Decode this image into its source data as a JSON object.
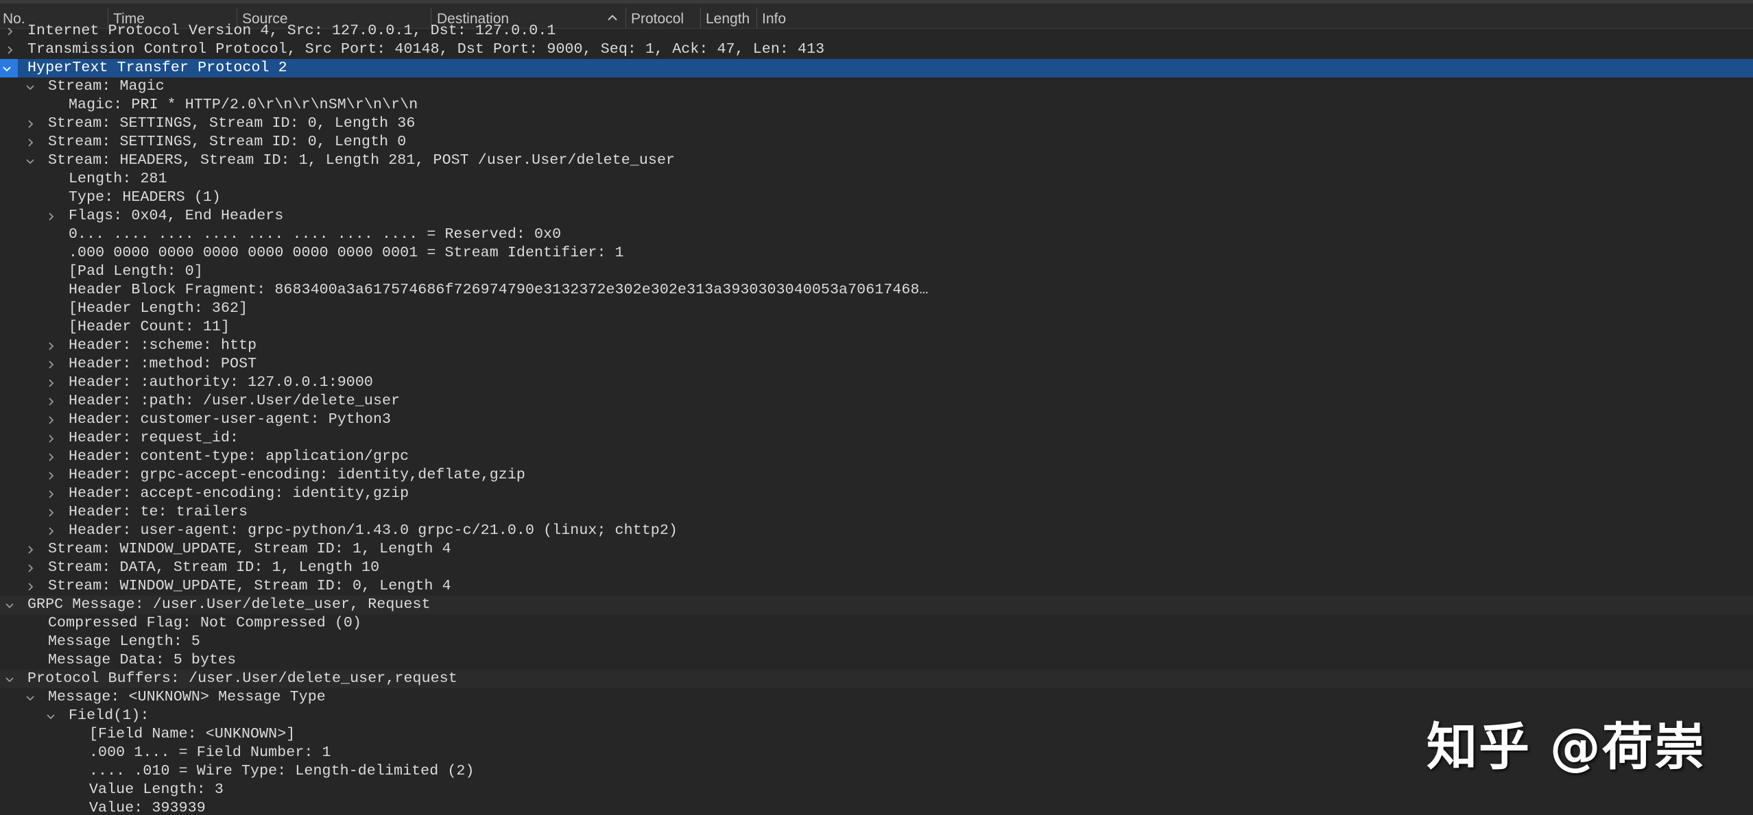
{
  "columns": {
    "no": "No.",
    "time": "Time",
    "source": "Source",
    "destination": "Destination",
    "protocol": "Protocol",
    "length": "Length",
    "info": "Info"
  },
  "tree": [
    {
      "depth": 0,
      "toggle": "collapsed",
      "text": "Internet Protocol Version 4, Src: 127.0.0.1, Dst: 127.0.0.1"
    },
    {
      "depth": 0,
      "toggle": "collapsed",
      "text": "Transmission Control Protocol, Src Port: 40148, Dst Port: 9000, Seq: 1, Ack: 47, Len: 413"
    },
    {
      "depth": 0,
      "toggle": "expanded",
      "text": "HyperText Transfer Protocol 2",
      "selected": true
    },
    {
      "depth": 1,
      "toggle": "expanded",
      "text": "Stream: Magic"
    },
    {
      "depth": 2,
      "toggle": "none",
      "text": "Magic: PRI * HTTP/2.0\\r\\n\\r\\nSM\\r\\n\\r\\n"
    },
    {
      "depth": 1,
      "toggle": "collapsed",
      "text": "Stream: SETTINGS, Stream ID: 0, Length 36"
    },
    {
      "depth": 1,
      "toggle": "collapsed",
      "text": "Stream: SETTINGS, Stream ID: 0, Length 0"
    },
    {
      "depth": 1,
      "toggle": "expanded",
      "text": "Stream: HEADERS, Stream ID: 1, Length 281, POST /user.User/delete_user"
    },
    {
      "depth": 2,
      "toggle": "none",
      "text": "Length: 281"
    },
    {
      "depth": 2,
      "toggle": "none",
      "text": "Type: HEADERS (1)"
    },
    {
      "depth": 2,
      "toggle": "collapsed",
      "text": "Flags: 0x04, End Headers"
    },
    {
      "depth": 2,
      "toggle": "none",
      "text": "0... .... .... .... .... .... .... .... = Reserved: 0x0"
    },
    {
      "depth": 2,
      "toggle": "none",
      "text": ".000 0000 0000 0000 0000 0000 0000 0001 = Stream Identifier: 1"
    },
    {
      "depth": 2,
      "toggle": "none",
      "text": "[Pad Length: 0]"
    },
    {
      "depth": 2,
      "toggle": "none",
      "text": "Header Block Fragment: 8683400a3a617574686f726974790e3132372e302e302e313a3930303040053a70617468…"
    },
    {
      "depth": 2,
      "toggle": "none",
      "text": "[Header Length: 362]"
    },
    {
      "depth": 2,
      "toggle": "none",
      "text": "[Header Count: 11]"
    },
    {
      "depth": 2,
      "toggle": "collapsed",
      "text": "Header: :scheme: http"
    },
    {
      "depth": 2,
      "toggle": "collapsed",
      "text": "Header: :method: POST"
    },
    {
      "depth": 2,
      "toggle": "collapsed",
      "text": "Header: :authority: 127.0.0.1:9000"
    },
    {
      "depth": 2,
      "toggle": "collapsed",
      "text": "Header: :path: /user.User/delete_user"
    },
    {
      "depth": 2,
      "toggle": "collapsed",
      "text": "Header: customer-user-agent: Python3"
    },
    {
      "depth": 2,
      "toggle": "collapsed",
      "text": "Header: request_id:"
    },
    {
      "depth": 2,
      "toggle": "collapsed",
      "text": "Header: content-type: application/grpc"
    },
    {
      "depth": 2,
      "toggle": "collapsed",
      "text": "Header: grpc-accept-encoding: identity,deflate,gzip"
    },
    {
      "depth": 2,
      "toggle": "collapsed",
      "text": "Header: accept-encoding: identity,gzip"
    },
    {
      "depth": 2,
      "toggle": "collapsed",
      "text": "Header: te: trailers"
    },
    {
      "depth": 2,
      "toggle": "collapsed",
      "text": "Header: user-agent: grpc-python/1.43.0 grpc-c/21.0.0 (linux; chttp2)"
    },
    {
      "depth": 1,
      "toggle": "collapsed",
      "text": "Stream: WINDOW_UPDATE, Stream ID: 1, Length 4"
    },
    {
      "depth": 1,
      "toggle": "collapsed",
      "text": "Stream: DATA, Stream ID: 1, Length 10"
    },
    {
      "depth": 1,
      "toggle": "collapsed",
      "text": "Stream: WINDOW_UPDATE, Stream ID: 0, Length 4"
    },
    {
      "depth": 0,
      "toggle": "expanded",
      "text": "GRPC Message: /user.User/delete_user, Request"
    },
    {
      "depth": 1,
      "toggle": "none",
      "text": "Compressed Flag: Not Compressed (0)"
    },
    {
      "depth": 1,
      "toggle": "none",
      "text": "Message Length: 5"
    },
    {
      "depth": 1,
      "toggle": "none",
      "text": "Message Data: 5 bytes"
    },
    {
      "depth": 0,
      "toggle": "expanded",
      "text": "Protocol Buffers: /user.User/delete_user,request"
    },
    {
      "depth": 1,
      "toggle": "expanded",
      "text": "Message: <UNKNOWN> Message Type"
    },
    {
      "depth": 2,
      "toggle": "expanded",
      "text": "Field(1):"
    },
    {
      "depth": 3,
      "toggle": "none",
      "text": "[Field Name: <UNKNOWN>]"
    },
    {
      "depth": 3,
      "toggle": "none",
      "text": ".000 1... = Field Number: 1"
    },
    {
      "depth": 3,
      "toggle": "none",
      "text": ".... .010 = Wire Type: Length-delimited (2)"
    },
    {
      "depth": 3,
      "toggle": "none",
      "text": "Value Length: 3"
    },
    {
      "depth": 3,
      "toggle": "none",
      "text": "Value: 393939"
    }
  ],
  "watermark": "知乎 @荷崇",
  "colors": {
    "background": "#262626",
    "selected_row": "#1c4f8c",
    "text": "#dcdcdc"
  }
}
